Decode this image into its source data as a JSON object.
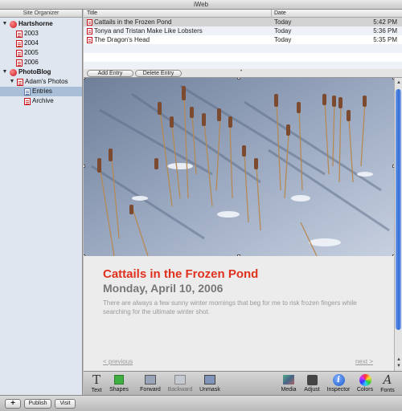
{
  "window": {
    "title": "iWeb"
  },
  "sidebar": {
    "header": "Site Organizer",
    "items": [
      {
        "label": "Hartshorne",
        "kind": "site",
        "level": 0,
        "expanded": true
      },
      {
        "label": "2003",
        "kind": "page",
        "level": 1
      },
      {
        "label": "2004",
        "kind": "page",
        "level": 1
      },
      {
        "label": "2005",
        "kind": "page",
        "level": 1
      },
      {
        "label": "2006",
        "kind": "page",
        "level": 1
      },
      {
        "label": "PhotoBlog",
        "kind": "site",
        "level": 0,
        "expanded": true
      },
      {
        "label": "Adam's Photos",
        "kind": "page",
        "level": 1,
        "expanded": true
      },
      {
        "label": "Entries",
        "kind": "subpage",
        "level": 2,
        "selected": true
      },
      {
        "label": "Archive",
        "kind": "page",
        "level": 2
      }
    ]
  },
  "entries": {
    "columns": {
      "title": "Title",
      "date": "Date"
    },
    "rows": [
      {
        "title": "Cattails in the Frozen Pond",
        "date": "Today",
        "time": "5:42 PM",
        "selected": true
      },
      {
        "title": "Tonya and Tristan Make Like Lobsters",
        "date": "Today",
        "time": "5:36 PM"
      },
      {
        "title": "The Dragon's Head",
        "date": "Today",
        "time": "5:35 PM"
      }
    ],
    "add_label": "Add Entry",
    "delete_label": "Delete Entry"
  },
  "post": {
    "title": "Cattails in the Frozen Pond",
    "date": "Monday, April 10, 2006",
    "body": "There are always a few sunny winter mornings that beg for me to risk frozen fingers while searching for the ultimate winter shot.",
    "prev": "< previous",
    "next": "next >"
  },
  "toolbar": {
    "text": "Text",
    "shapes": "Shapes",
    "forward": "Forward",
    "backward": "Backward",
    "unmask": "Unmask",
    "media": "Media",
    "adjust": "Adjust",
    "inspector": "Inspector",
    "colors": "Colors",
    "fonts": "Fonts"
  },
  "bottom": {
    "add": "+",
    "publish": "Publish",
    "visit": "Visit"
  },
  "colors": {
    "accent": "#e0301e",
    "date": "#777777",
    "selection": "#a9bfd8",
    "scrollbar": "#2f6ad6"
  }
}
